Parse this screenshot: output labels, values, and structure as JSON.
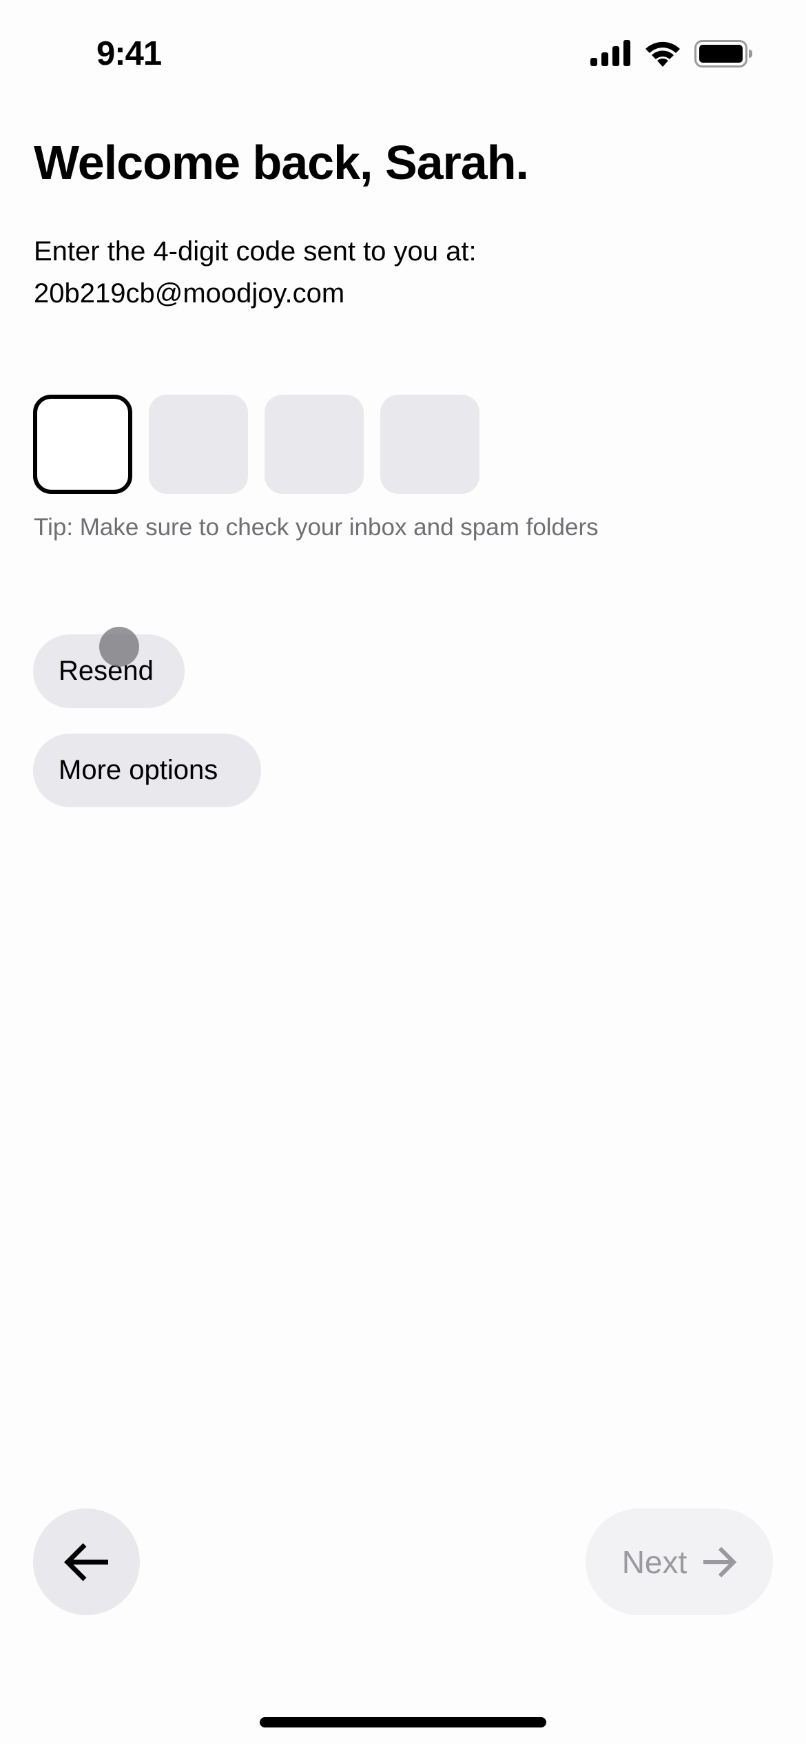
{
  "status_bar": {
    "time": "9:41",
    "icons": [
      "signal-icon",
      "wifi-icon",
      "battery-icon"
    ]
  },
  "header": {
    "title": "Welcome back, Sarah."
  },
  "instructions": {
    "line1": "Enter the 4-digit code sent to you at:",
    "email": "20b219cb@moodjoy.com"
  },
  "code_input": {
    "length": 4,
    "digits": [
      "",
      "",
      "",
      ""
    ],
    "active_index": 0
  },
  "tip": "Tip: Make sure to check your inbox and spam folders",
  "actions": {
    "resend_label": "Resend",
    "more_options_label": "More options"
  },
  "navigation": {
    "back_icon": "arrow-left-icon",
    "next_label": "Next",
    "next_icon": "arrow-right-icon",
    "next_enabled": false
  },
  "colors": {
    "input_fill": "#e9e8ec",
    "active_border": "#000000",
    "tip_text": "#6e6e73",
    "disabled_text": "#9a9a9e"
  }
}
